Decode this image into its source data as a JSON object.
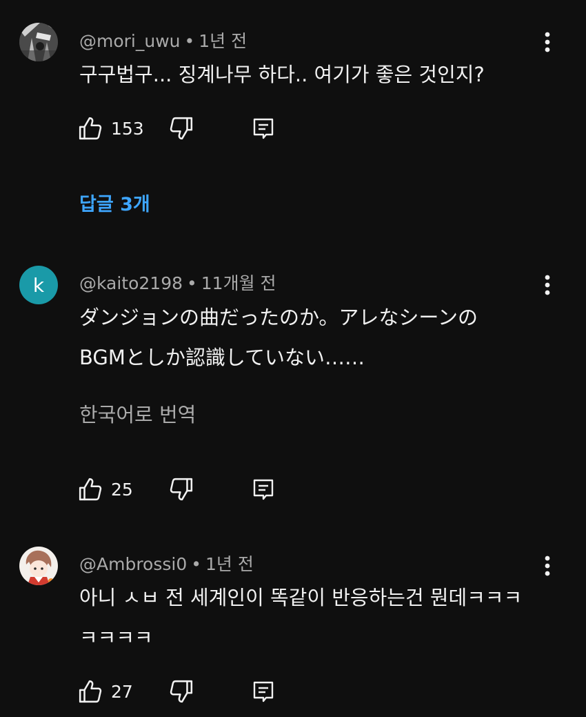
{
  "comments": [
    {
      "author": "@mori_uwu",
      "time": "1년 전",
      "separator": "•",
      "lines": [
        "구구법구... 징계나무 하다.. 여기가 좋은 것인지?"
      ],
      "likes": "153",
      "avatar_icon": "avatar-image-icon",
      "replies_label": "답글 3개"
    },
    {
      "author": "@kaito2198",
      "time": "11개월 전",
      "separator": "•",
      "avatar_letter": "k",
      "avatar_color": "#1a9aa8",
      "lines": [
        "ダンジョンの曲だったのか。アレなシーンの",
        "BGMとしか認識していない……"
      ],
      "translate_label": "한국어로 번역",
      "likes": "25"
    },
    {
      "author": "@Ambrossi0",
      "time": "1년 전",
      "separator": "•",
      "avatar_icon": "avatar-anime-character-icon",
      "lines": [
        "아니 ㅅㅂ 전 세계인이 똑같이 반응하는건 뭔데ㅋㅋㅋ",
        "ㅋㅋㅋㅋ"
      ],
      "likes": "27"
    }
  ],
  "icons": {
    "like": "thumbs-up-icon",
    "dislike": "thumbs-down-icon",
    "reply": "reply-icon",
    "more": "more-vertical-icon"
  },
  "colors": {
    "background": "#0f0f0f",
    "link": "#3ea6ff",
    "secondary_text": "#aaaaaa"
  }
}
